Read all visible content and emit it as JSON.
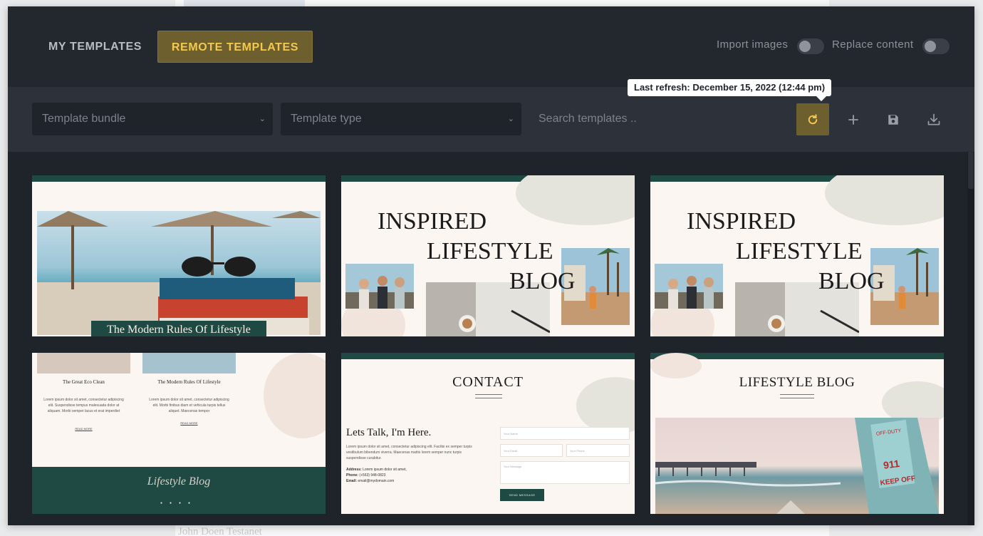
{
  "header": {
    "tabs": [
      {
        "label": "MY TEMPLATES",
        "active": false
      },
      {
        "label": "REMOTE TEMPLATES",
        "active": true
      }
    ],
    "import_images_label": "Import images",
    "replace_content_label": "Replace content",
    "import_images_on": false,
    "replace_content_on": false
  },
  "toolbar": {
    "bundle_placeholder": "Template bundle",
    "type_placeholder": "Template type",
    "search_placeholder": "Search templates ..",
    "refresh_tooltip": "Last refresh: December 15, 2022 (12:44 pm)",
    "icons": [
      "refresh-icon",
      "plus-icon",
      "save-icon",
      "download-icon"
    ]
  },
  "colors": {
    "accent": "#f2c94c",
    "accent_bg": "#6e5f2e",
    "modal_bg": "#1f232a",
    "brand_green": "#1f4a43"
  },
  "templates": [
    {
      "title": "The Modern Rules Of Lifestyle",
      "book_top": "Curtis Kelly",
      "book_blue": "It Started with Paris",
      "book_red": "John Grisham"
    },
    {
      "line1": "INSPIRED",
      "line2": "LIFESTYLE",
      "line3": "BLOG"
    },
    {
      "line1": "INSPIRED",
      "line2": "LIFESTYLE",
      "line3": "BLOG"
    },
    {
      "post1_title": "The Great Eco Clean",
      "post1_text": "Lorem ipsum dolor sit amet, consectetur adipiscing elit. Suspendisse tempus malesuada dolor at aliquam. Morbi semper lacus et erat imperdiet",
      "post2_title": "The Modern Rules Of Lifestyle",
      "post2_text": "Lorem ipsum dolor sit amet, consectetur adipiscing elit. Morbi finibus diam et vehicula turpis tellus aliquet. Maecenas tempor",
      "read_more": "READ MORE",
      "footer_logo": "Lifestyle Blog"
    },
    {
      "heading": "CONTACT",
      "subheading": "Lets Talk, I'm Here.",
      "body": "Lorem ipsum dolor sit amet, consectetur adipiscing elit. Facilisi ex semper turpis vestibulum bibendum viverra. Maecenas mattis lorem semper nunc turpis suspendisse curabitur.",
      "address_label": "Address:",
      "address_value": "Lorem ipsum dolor sit amet,",
      "phone_label": "Phone:",
      "phone_value": "(+563) 948-0823",
      "email_label": "Email:",
      "email_value": "email@mydomain.com",
      "name_placeholder": "Your Name",
      "email_placeholder": "Your Email",
      "phone_placeholder": "Your Phone",
      "message_placeholder": "Your Message",
      "send_label": "SEND MESSAGE"
    },
    {
      "heading": "LIFESTYLE BLOG",
      "sign_line1": "OFF-DUTY",
      "sign_line2": "911",
      "sign_line3": "KEEP OFF"
    }
  ],
  "background": {
    "bottom_text": "John Doen Testanet"
  }
}
